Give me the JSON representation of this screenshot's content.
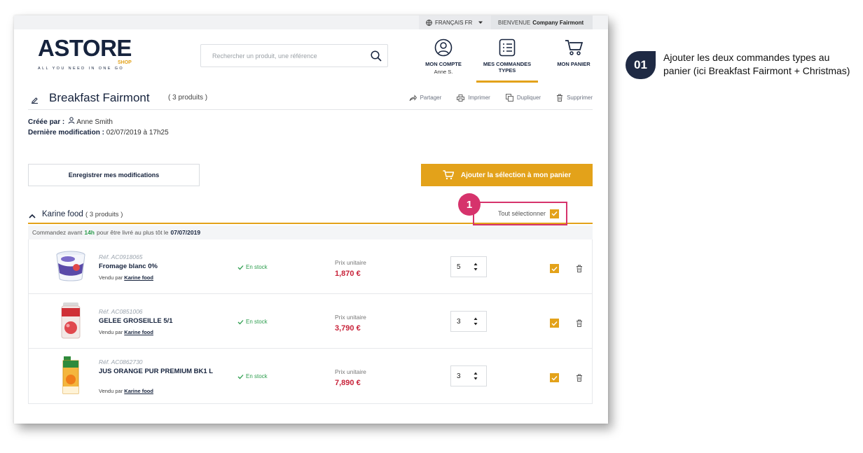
{
  "topbar": {
    "language": "FRANÇAIS FR",
    "welcome_prefix": "BIENVENUE",
    "company": "Company Fairmont"
  },
  "logo": {
    "brand": "ASTORE",
    "sub": "SHOP",
    "tagline": "ALL YOU NEED IN ONE GO"
  },
  "search": {
    "placeholder": "Rechercher un produit, une référence"
  },
  "nav": {
    "account_label": "MON COMPTE",
    "account_user": "Anne S.",
    "orders_label_1": "MES COMMANDES",
    "orders_label_2": "TYPES",
    "cart_label": "MON PANIER"
  },
  "page": {
    "title": "Breakfast Fairmont",
    "count": "( 3 produits )",
    "actions": {
      "share": "Partager",
      "print": "Imprimer",
      "duplicate": "Dupliquer",
      "delete": "Supprimer"
    },
    "created_by_label": "Créée par :",
    "created_by": "Anne Smith",
    "modified_label": "Dernière modification :",
    "modified_value": "02/07/2019 à 17h25",
    "save_button": "Enregistrer mes modifications",
    "add_button": "Ajouter la sélection à mon panier"
  },
  "section": {
    "title": "Karine food",
    "count": "( 3 produits )",
    "select_all": "Tout sélectionner",
    "marker": "1",
    "deliver_prefix": "Commandez avant",
    "deliver_hour": "14h",
    "deliver_middle": "pour être livré au plus tôt le",
    "deliver_date": "07/07/2019"
  },
  "products": [
    {
      "ref": "Réf. AC0918065",
      "name": "Fromage blanc 0%",
      "vendor_label": "Vendu par",
      "vendor": "Karine food",
      "stock": "En stock",
      "unit_label": "Prix unitaire",
      "price": "1,870 €",
      "qty": "5"
    },
    {
      "ref": "Réf. AC0851006",
      "name": "GELEE GROSEILLE 5/1",
      "vendor_label": "Vendu par",
      "vendor": "Karine food",
      "stock": "En stock",
      "unit_label": "Prix unitaire",
      "price": "3,790 €",
      "qty": "3"
    },
    {
      "ref": "Réf. AC0862730",
      "name": "JUS ORANGE PUR PREMIUM BK1 L",
      "vendor_label": "Vendu par",
      "vendor": "Karine food",
      "stock": "En stock",
      "unit_label": "Prix unitaire",
      "price": "7,890 €",
      "qty": "3"
    }
  ],
  "annotation": {
    "step": "01",
    "text": "Ajouter les deux commandes types au panier (ici Breakfast Fairmont + Christmas)"
  },
  "colors": {
    "accent": "#e3a21a",
    "navy": "#16233d",
    "highlight": "#d6336c",
    "price": "#c8233a",
    "stock": "#2e9e4f"
  }
}
